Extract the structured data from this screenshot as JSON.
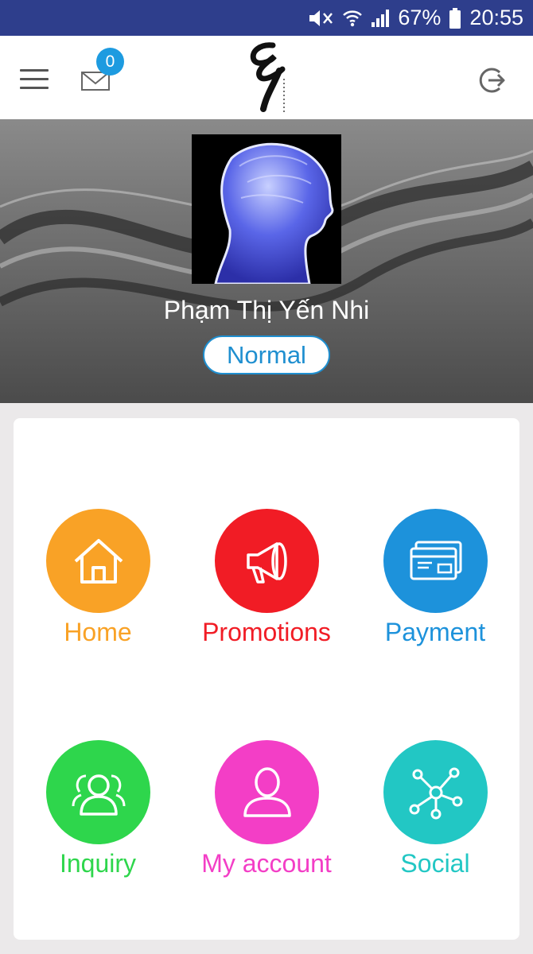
{
  "status_bar": {
    "battery": "67%",
    "time": "20:55"
  },
  "header": {
    "mail_count": "0"
  },
  "profile": {
    "name": "Phạm Thị Yến Nhi",
    "level": "Normal"
  },
  "menu": [
    {
      "label": "Home",
      "icon": "home-icon",
      "color": "#f9a226"
    },
    {
      "label": "Promotions",
      "icon": "megaphone-icon",
      "color": "#f11c25"
    },
    {
      "label": "Payment",
      "icon": "credit-card-icon",
      "color": "#1d92db"
    },
    {
      "label": "Inquiry",
      "icon": "users-icon",
      "color": "#2ed64c"
    },
    {
      "label": "My account",
      "icon": "user-icon",
      "color": "#f33ec6"
    },
    {
      "label": "Social",
      "icon": "share-network-icon",
      "color": "#22c7c4"
    }
  ]
}
